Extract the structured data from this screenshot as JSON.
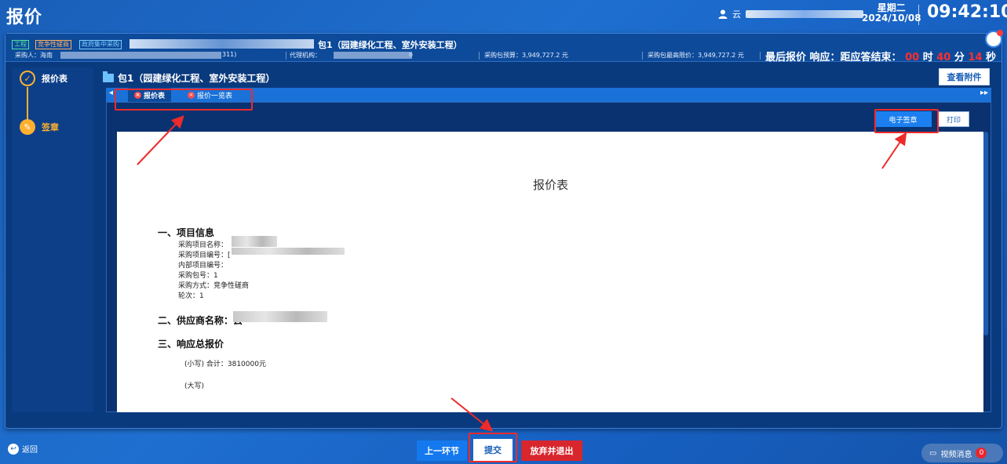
{
  "header": {
    "app_title": "报价",
    "user_initial": "云",
    "weekday": "星期二",
    "date": "2024/10/08",
    "time": "09:42:10"
  },
  "info_bar": {
    "tags": [
      "工程",
      "竞争性磋商",
      "政府集中采购"
    ],
    "project_suffix": "包1（园建绿化工程、室外安装工程）",
    "buyer_label": "采购人：海南",
    "buyer_tail": "311)",
    "agency_label": "代理机构：",
    "agency_tail": "o",
    "budget": "采购包预算：3,949,727.2 元",
    "max_price": "采购包最高限价：3,949,727.2 元",
    "countdown": {
      "prefix": "最后报价 响应：距应答结束：",
      "hours": "00",
      "h_unit": "时",
      "minutes": "40",
      "m_unit": "分",
      "seconds": "14",
      "s_unit": "秒"
    }
  },
  "steps": [
    {
      "label": "报价表",
      "state": "done"
    },
    {
      "label": "签章",
      "state": "current"
    }
  ],
  "content": {
    "package_title": "包1（园建绿化工程、室外安装工程）",
    "attach_button": "查看附件",
    "tabs": [
      {
        "label": "报价表",
        "active": true
      },
      {
        "label": "报价一览表",
        "active": false
      }
    ],
    "esign_button": "电子签章",
    "print_button": "打印"
  },
  "document": {
    "title": "报价表",
    "section1": "一、项目信息",
    "fields": [
      "采购项目名称：",
      "采购项目编号：[",
      "内部项目编号：",
      "采购包号：1",
      "采购方式：竞争性磋商",
      "轮次：1"
    ],
    "section2": "二、供应商名称：云",
    "section3": "三、响应总报价",
    "amount_lower": "(小写) 合计：3810000元",
    "amount_upper": "(大写)"
  },
  "footer": {
    "back": "返回",
    "prev_button": "上一环节",
    "submit_button": "提交",
    "quit_button": "放弃并退出",
    "video_msg": "视频消息",
    "video_count": "0"
  },
  "colors": {
    "accent": "#1479ee",
    "danger": "#d8262d",
    "step": "#ffb030",
    "countdown": "#ff2e2e"
  }
}
